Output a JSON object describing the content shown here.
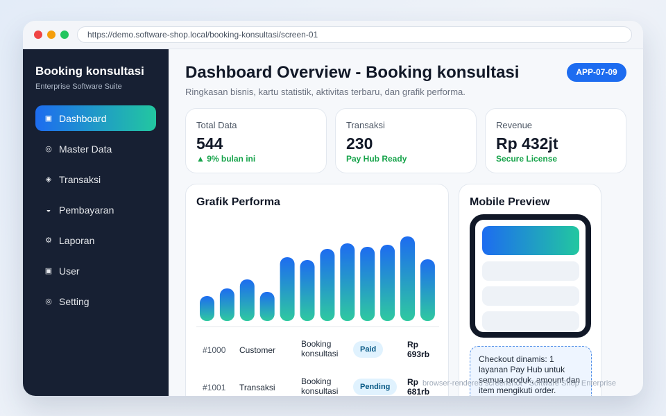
{
  "browser": {
    "url": "https://demo.software-shop.local/booking-konsultasi/screen-01"
  },
  "sidebar": {
    "brand_title": "Booking konsultasi",
    "brand_subtitle": "Enterprise Software Suite",
    "items": [
      {
        "icon": "▣",
        "icon_name": "dashboard-icon",
        "label": "Dashboard",
        "active": true
      },
      {
        "icon": "◎",
        "icon_name": "master-data-icon",
        "label": "Master Data"
      },
      {
        "icon": "◈",
        "icon_name": "transaction-icon",
        "label": "Transaksi"
      },
      {
        "icon": "◒",
        "icon_name": "payment-icon",
        "label": "Pembayaran"
      },
      {
        "icon": "⚙",
        "icon_name": "report-icon",
        "label": "Laporan"
      },
      {
        "icon": "▣",
        "icon_name": "user-icon",
        "label": "User"
      },
      {
        "icon": "◎",
        "icon_name": "setting-icon",
        "label": "Setting"
      }
    ]
  },
  "header": {
    "title": "Dashboard Overview - Booking konsultasi",
    "subtitle": "Ringkasan bisnis, kartu statistik, aktivitas terbaru, dan grafik performa.",
    "badge": "APP-07-09"
  },
  "stats": [
    {
      "label": "Total Data",
      "value": "544",
      "note": "▲ 9% bulan ini"
    },
    {
      "label": "Transaksi",
      "value": "230",
      "note": "Pay Hub Ready"
    },
    {
      "label": "Revenue",
      "value": "Rp 432jt",
      "note": "Secure License"
    }
  ],
  "chart": {
    "title": "Grafik Performa"
  },
  "chart_data": {
    "type": "bar",
    "values": [
      36,
      47,
      60,
      42,
      92,
      88,
      104,
      112,
      107,
      110,
      122,
      89
    ],
    "ylim": [
      0,
      130
    ],
    "grid": false,
    "colors": [
      "#1d6cf0",
      "#2fc9a0"
    ]
  },
  "transactions": [
    {
      "id": "#1000",
      "customer": "Customer",
      "product": "Booking konsultasi",
      "status": "Paid",
      "amount": "Rp 693rb"
    },
    {
      "id": "#1001",
      "customer": "Transaksi",
      "product": "Booking konsultasi",
      "status": "Pending",
      "amount": "Rp 681rb"
    }
  ],
  "mobile": {
    "title": "Mobile Preview",
    "checkout_text": "Checkout dinamis: 1 layanan Pay Hub untuk semua produk, amount dan item mengikuti order."
  },
  "footer": "browser-rendered screenshot • Software Shop Enterprise"
}
